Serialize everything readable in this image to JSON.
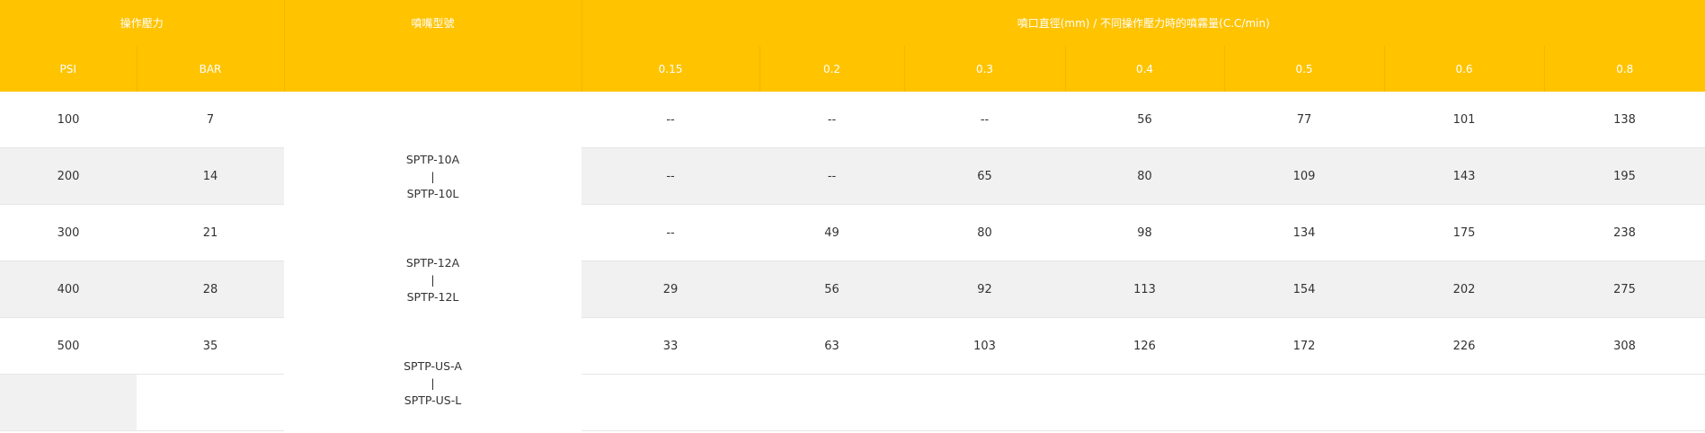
{
  "table": {
    "header": {
      "pressure_group": "操作壓力",
      "model_group": "噴嘴型號",
      "flow_group": "噴口直徑(mm) / 不同操作壓力時的噴霧量(C.C/min)",
      "psi": "PSI",
      "bar": "BAR",
      "diameters": [
        "0.15",
        "0.2",
        "0.3",
        "0.4",
        "0.5",
        "0.6",
        "0.8"
      ]
    },
    "models": [
      {
        "top": "SPTP-10A",
        "sep": "|",
        "bottom": "SPTP-10L"
      },
      {
        "top": "SPTP-12A",
        "sep": "|",
        "bottom": "SPTP-12L"
      },
      {
        "top": "SPTP-US-A",
        "sep": "|",
        "bottom": "SPTP-US-L"
      }
    ],
    "rows": [
      {
        "psi": "100",
        "bar": "7",
        "values": [
          "--",
          "--",
          "--",
          "56",
          "77",
          "101",
          "138"
        ]
      },
      {
        "psi": "200",
        "bar": "14",
        "values": [
          "--",
          "--",
          "65",
          "80",
          "109",
          "143",
          "195"
        ]
      },
      {
        "psi": "300",
        "bar": "21",
        "values": [
          "--",
          "49",
          "80",
          "98",
          "134",
          "175",
          "238"
        ]
      },
      {
        "psi": "400",
        "bar": "28",
        "values": [
          "29",
          "56",
          "92",
          "113",
          "154",
          "202",
          "275"
        ]
      },
      {
        "psi": "500",
        "bar": "35",
        "values": [
          "33",
          "63",
          "103",
          "126",
          "172",
          "226",
          "308"
        ]
      }
    ]
  }
}
